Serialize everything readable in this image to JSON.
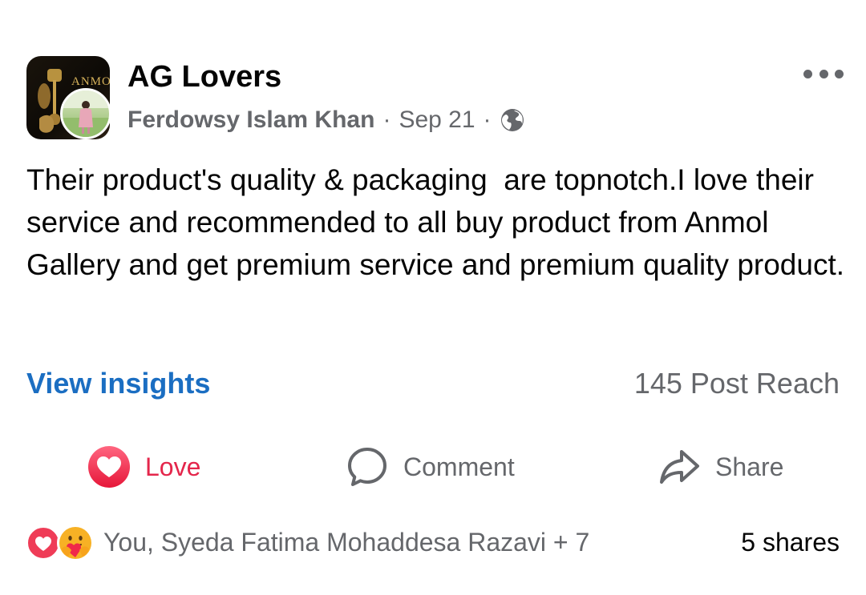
{
  "post": {
    "page_name": "AG Lovers",
    "avatar_wordmark": "ANMOL",
    "author": "Ferdowsy Islam Khan",
    "date": "Sep 21",
    "separator": "·",
    "audience_icon": "globe-icon",
    "menu_icon": "more-horizontal-icon",
    "text": "Their product's quality & packaging  are topnotch.I love their service and recommended to all buy product from Anmol Gallery and get premium service and premium quality product."
  },
  "insights": {
    "link_label": "View insights",
    "reach_label": "145 Post Reach"
  },
  "actions": {
    "love": {
      "label": "Love",
      "icon": "love-reaction-icon",
      "color": "#e4264b",
      "active": true
    },
    "comment": {
      "label": "Comment",
      "icon": "comment-icon"
    },
    "share": {
      "label": "Share",
      "icon": "share-icon"
    }
  },
  "summary": {
    "reaction_icons": [
      "love-reaction-icon",
      "care-reaction-icon"
    ],
    "reactors": "You, Syeda Fatima Mohaddesa Razavi + 7",
    "shares": "5 shares"
  },
  "colors": {
    "link": "#1b6ec2",
    "secondary_text": "#65676b",
    "love": "#ef3c57"
  }
}
